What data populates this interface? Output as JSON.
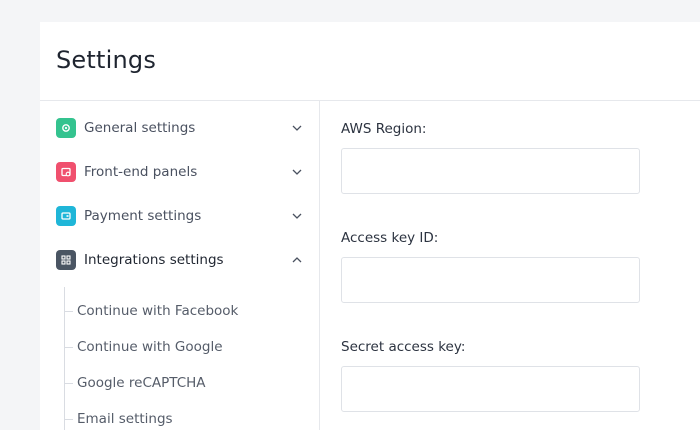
{
  "page": {
    "title": "Settings"
  },
  "sidebar": {
    "items": [
      {
        "label": "General settings",
        "icon": "gear-icon",
        "color": "#34c38f",
        "expanded": false
      },
      {
        "label": "Front-end panels",
        "icon": "panel-icon",
        "color": "#f0506e",
        "expanded": false
      },
      {
        "label": "Payment settings",
        "icon": "wallet-icon",
        "color": "#1fb6d8",
        "expanded": false
      },
      {
        "label": "Integrations settings",
        "icon": "integrations-icon",
        "color": "#4a5563",
        "expanded": true
      }
    ],
    "sub_items": [
      {
        "label": "Continue with Facebook"
      },
      {
        "label": "Continue with Google"
      },
      {
        "label": "Google reCAPTCHA"
      },
      {
        "label": "Email settings"
      }
    ]
  },
  "form": {
    "fields": [
      {
        "label": "AWS Region:",
        "value": ""
      },
      {
        "label": "Access key ID:",
        "value": ""
      },
      {
        "label": "Secret access key:",
        "value": ""
      }
    ]
  }
}
